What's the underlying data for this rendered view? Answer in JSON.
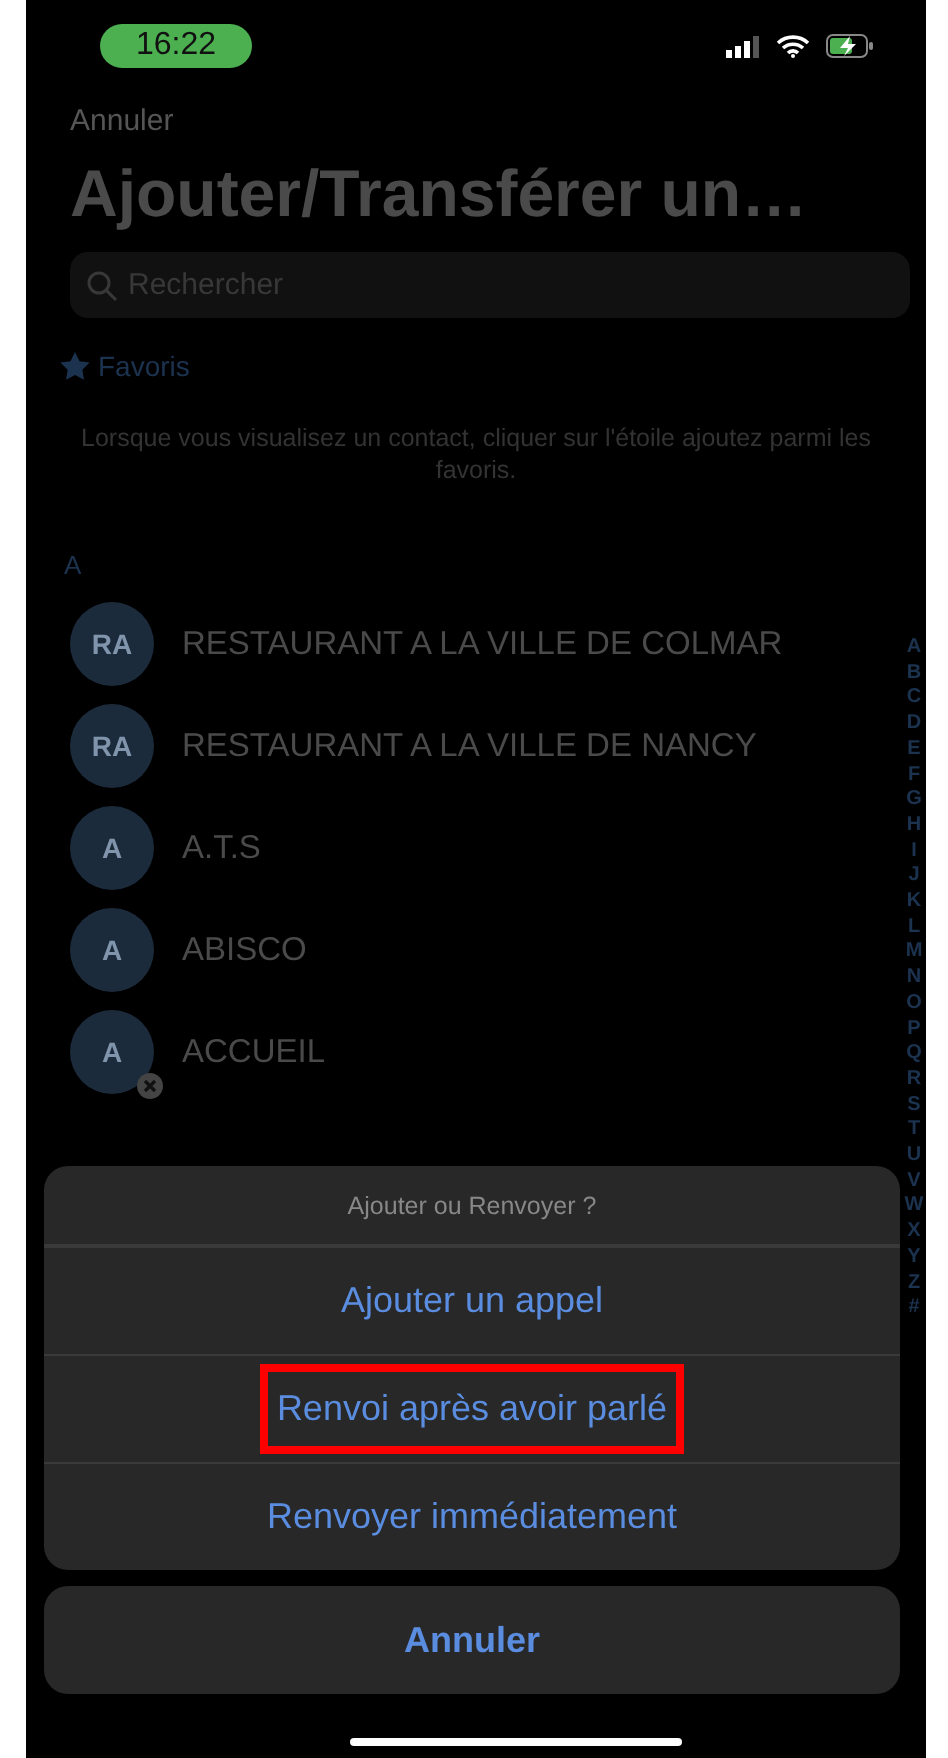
{
  "status_bar": {
    "time": "16:22"
  },
  "nav": {
    "back": "Annuler",
    "title": "Ajouter/Transférer un…"
  },
  "search": {
    "placeholder": "Rechercher"
  },
  "favorites": {
    "label": "Favoris",
    "hint": "Lorsque vous visualisez un contact, cliquer sur l'étoile ajoutez parmi les favoris."
  },
  "section": "A",
  "contacts": [
    {
      "initials": "RA",
      "name": "RESTAURANT A LA VILLE DE COLMAR",
      "removable": false
    },
    {
      "initials": "RA",
      "name": "RESTAURANT A LA VILLE DE NANCY",
      "removable": false
    },
    {
      "initials": "A",
      "name": "A.T.S",
      "removable": false
    },
    {
      "initials": "A",
      "name": "ABISCO",
      "removable": false
    },
    {
      "initials": "A",
      "name": "ACCUEIL",
      "removable": true
    }
  ],
  "index": [
    "A",
    "B",
    "C",
    "D",
    "E",
    "F",
    "G",
    "H",
    "I",
    "J",
    "K",
    "L",
    "M",
    "N",
    "O",
    "P",
    "Q",
    "R",
    "S",
    "T",
    "U",
    "V",
    "W",
    "X",
    "Y",
    "Z",
    "#"
  ],
  "action_sheet": {
    "title": "Ajouter ou Renvoyer ?",
    "options": [
      {
        "label": "Ajouter un appel",
        "highlighted": false
      },
      {
        "label": "Renvoi après avoir parlé",
        "highlighted": true
      },
      {
        "label": "Renvoyer immédiatement",
        "highlighted": false
      }
    ],
    "cancel": "Annuler"
  }
}
